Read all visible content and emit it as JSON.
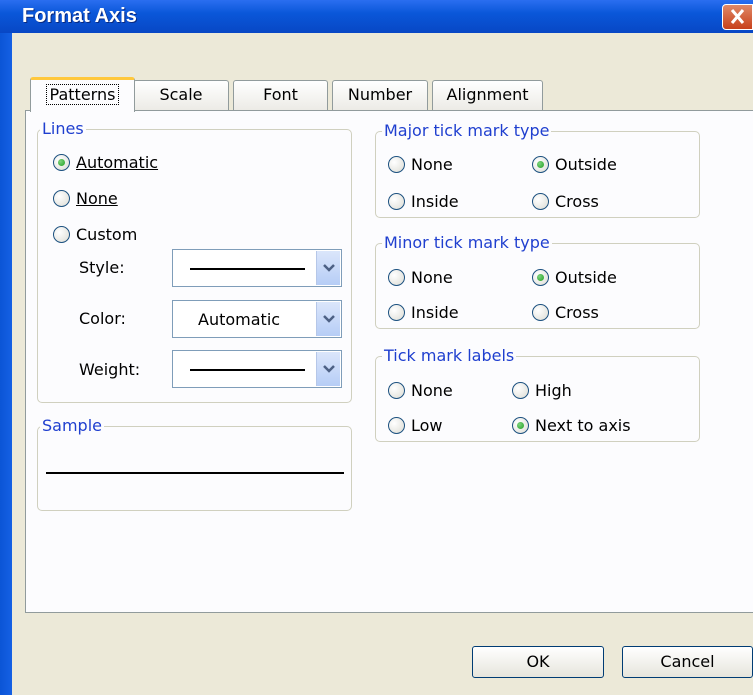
{
  "window": {
    "title": "Format Axis"
  },
  "tabs": [
    {
      "label": "Patterns",
      "active": true
    },
    {
      "label": "Scale"
    },
    {
      "label": "Font"
    },
    {
      "label": "Number"
    },
    {
      "label": "Alignment"
    }
  ],
  "lines": {
    "legend": "Lines",
    "automatic": "Automatic",
    "none": "None",
    "custom": "Custom",
    "selected": "Automatic",
    "style_label": "Style:",
    "color_label": "Color:",
    "color_value": "Automatic",
    "weight_label": "Weight:"
  },
  "sample": {
    "legend": "Sample"
  },
  "major": {
    "legend": "Major tick mark type",
    "none": "None",
    "outside": "Outside",
    "inside": "Inside",
    "cross": "Cross",
    "selected": "Outside"
  },
  "minor": {
    "legend": "Minor tick mark type",
    "none": "None",
    "outside": "Outside",
    "inside": "Inside",
    "cross": "Cross",
    "selected": "Outside"
  },
  "labels": {
    "legend": "Tick mark labels",
    "none": "None",
    "high": "High",
    "low": "Low",
    "next": "Next to axis",
    "selected": "Next to axis"
  },
  "buttons": {
    "ok": "OK",
    "cancel": "Cancel"
  },
  "colors": {
    "title_bar": "#0a57d9",
    "dialog_bg": "#ece9d8",
    "legend_text": "#1f3fcf",
    "active_tab_highlight": "#ffc83c",
    "radio_selected": "#21a121"
  }
}
